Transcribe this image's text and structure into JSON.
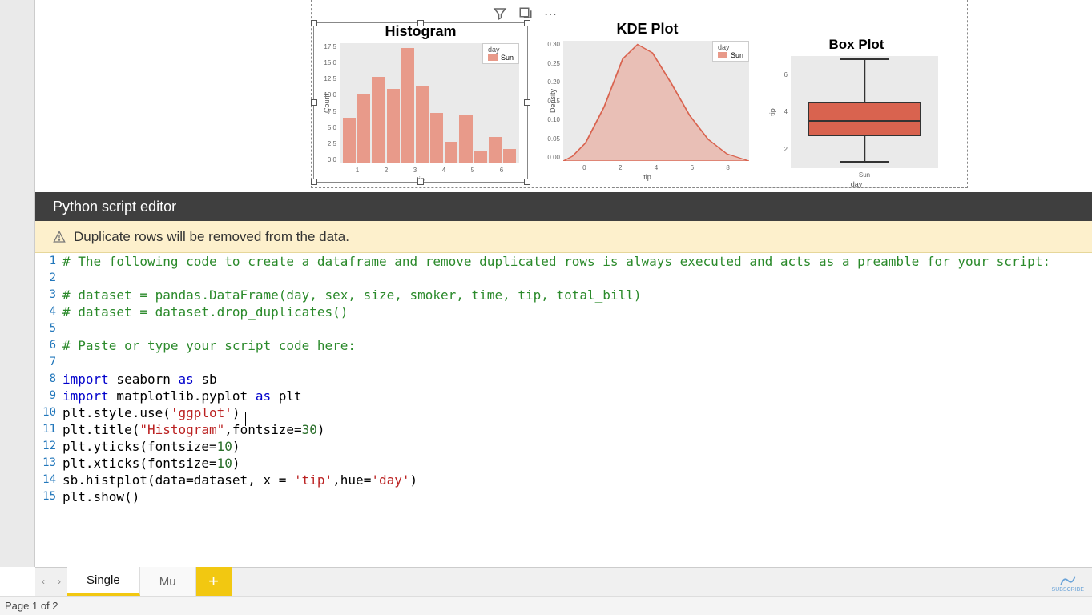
{
  "canvas": {
    "toolbar_icons": [
      "filter-icon",
      "focus-icon",
      "more-icon"
    ]
  },
  "charts": [
    {
      "title": "Histogram",
      "type": "bar",
      "xlabel": "tip",
      "ylabel": "Count",
      "legend_title": "day",
      "legend_items": [
        "Sun"
      ],
      "xticks": [
        "1",
        "2",
        "3",
        "4",
        "5",
        "6"
      ],
      "yticks": [
        "17.5",
        "15.0",
        "12.5",
        "10.0",
        "7.5",
        "5.0",
        "2.5",
        "0.0"
      ],
      "bar_heights_pct": [
        38,
        58,
        72,
        62,
        96,
        65,
        42,
        18,
        40,
        10,
        22,
        12
      ]
    },
    {
      "title": "KDE Plot",
      "type": "line",
      "xlabel": "tip",
      "ylabel": "Density",
      "legend_title": "day",
      "legend_items": [
        "Sun"
      ],
      "xticks": [
        "0",
        "2",
        "4",
        "6",
        "8"
      ],
      "yticks": [
        "0.30",
        "0.25",
        "0.20",
        "0.15",
        "0.10",
        "0.05",
        "0.00"
      ]
    },
    {
      "title": "Box Plot",
      "type": "box",
      "xlabel": "day",
      "ylabel": "tip",
      "xticks": [
        "Sun"
      ],
      "yticks": [
        "6",
        "4",
        "2"
      ]
    }
  ],
  "editor": {
    "header": "Python script editor",
    "warning": "Duplicate rows will be removed from the data.",
    "lines": {
      "1": "# The following code to create a dataframe and remove duplicated rows is always executed and acts as a preamble for your script:",
      "3": "# dataset = pandas.DataFrame(day, sex, size, smoker, time, tip, total_bill)",
      "4": "# dataset = dataset.drop_duplicates()",
      "6": "# Paste or type your script code here:",
      "8a": "import",
      "8b": " seaborn ",
      "8c": "as",
      "8d": " sb",
      "9a": "import",
      "9b": " matplotlib.pyplot ",
      "9c": "as",
      "9d": " plt",
      "10a": "plt.style.use(",
      "10b": "'ggplot'",
      "10c": ")",
      "11a": "plt.title(",
      "11b": "\"Histogram\"",
      "11c": ",fontsize=",
      "11d": "30",
      "11e": ")",
      "12a": "plt.yticks(fontsize=",
      "12b": "10",
      "12c": ")",
      "13a": "plt.xticks(fontsize=",
      "13b": "10",
      "13c": ")",
      "14a": "sb.histplot(data=dataset, x = ",
      "14b": "'tip'",
      "14c": ",hue=",
      "14d": "'day'",
      "14e": ")",
      "15": "plt.show()"
    }
  },
  "tabs": {
    "prev": "‹",
    "next": "›",
    "items": [
      "Single",
      "Mu"
    ],
    "active_index": 0,
    "add": "+"
  },
  "status": {
    "text": "Page 1 of 2"
  },
  "subscribe": "SUBSCRIBE",
  "chart_data": [
    {
      "type": "bar",
      "title": "Histogram",
      "xlabel": "tip",
      "ylabel": "Count",
      "categories": [
        1.0,
        1.5,
        2.0,
        2.5,
        3.0,
        3.5,
        4.0,
        4.5,
        5.0,
        5.5,
        6.0,
        6.5
      ],
      "series": [
        {
          "name": "Sun",
          "values": [
            7,
            10,
            13,
            11,
            17,
            11,
            7,
            3,
            7,
            2,
            4,
            2
          ]
        }
      ],
      "ylim": [
        0,
        17.5
      ]
    },
    {
      "type": "line",
      "title": "KDE Plot",
      "xlabel": "tip",
      "ylabel": "Density",
      "x": [
        0,
        1,
        2,
        3,
        4,
        5,
        6,
        7,
        8,
        9
      ],
      "series": [
        {
          "name": "Sun",
          "values": [
            0.0,
            0.08,
            0.22,
            0.3,
            0.24,
            0.14,
            0.08,
            0.04,
            0.02,
            0.0
          ]
        }
      ],
      "ylim": [
        0,
        0.3
      ]
    },
    {
      "type": "box",
      "title": "Box Plot",
      "xlabel": "day",
      "ylabel": "tip",
      "categories": [
        "Sun"
      ],
      "boxes": [
        {
          "min": 1.0,
          "q1": 2.1,
          "median": 3.0,
          "q3": 3.8,
          "max": 6.5
        }
      ]
    }
  ]
}
